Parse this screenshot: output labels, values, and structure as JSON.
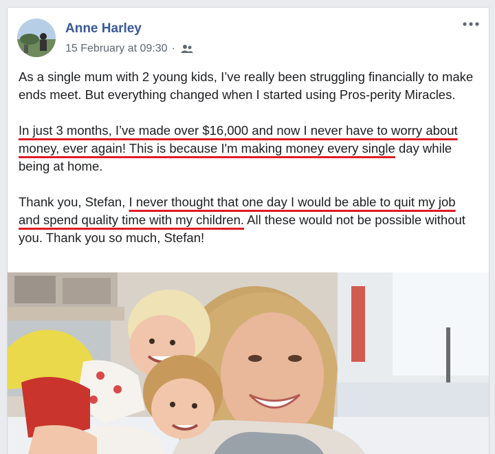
{
  "post": {
    "author": "Anne Harley",
    "timestamp": "15 February at 09:30",
    "separator": "·",
    "audience_icon": "friends-icon",
    "more_icon": "more-options-icon",
    "paragraphs": [
      {
        "spans": [
          {
            "text": "As a single mum with 2 young kids, I’ve really been struggling financially to make ends meet. But everything changed when I started using Pros-perity Miracles.",
            "underline": false
          }
        ]
      },
      {
        "spans": [
          {
            "text": "In just 3 months, I’ve made over $16,000 and now I never have to worry about money, ever again! This is because I'm making money every single",
            "underline": true
          },
          {
            "text": " day while being at home.",
            "underline": false
          }
        ]
      },
      {
        "spans": [
          {
            "text": "Thank you, Stefan, ",
            "underline": false
          },
          {
            "text": "I never thought that one day I would be able to quit my job and spend quality time with my children.",
            "underline": true
          },
          {
            "text": " All these would not be possible without you. Thank you so much, Stefan!",
            "underline": false
          }
        ]
      }
    ],
    "underline_color": "#e01a22",
    "link_color": "#385898"
  }
}
